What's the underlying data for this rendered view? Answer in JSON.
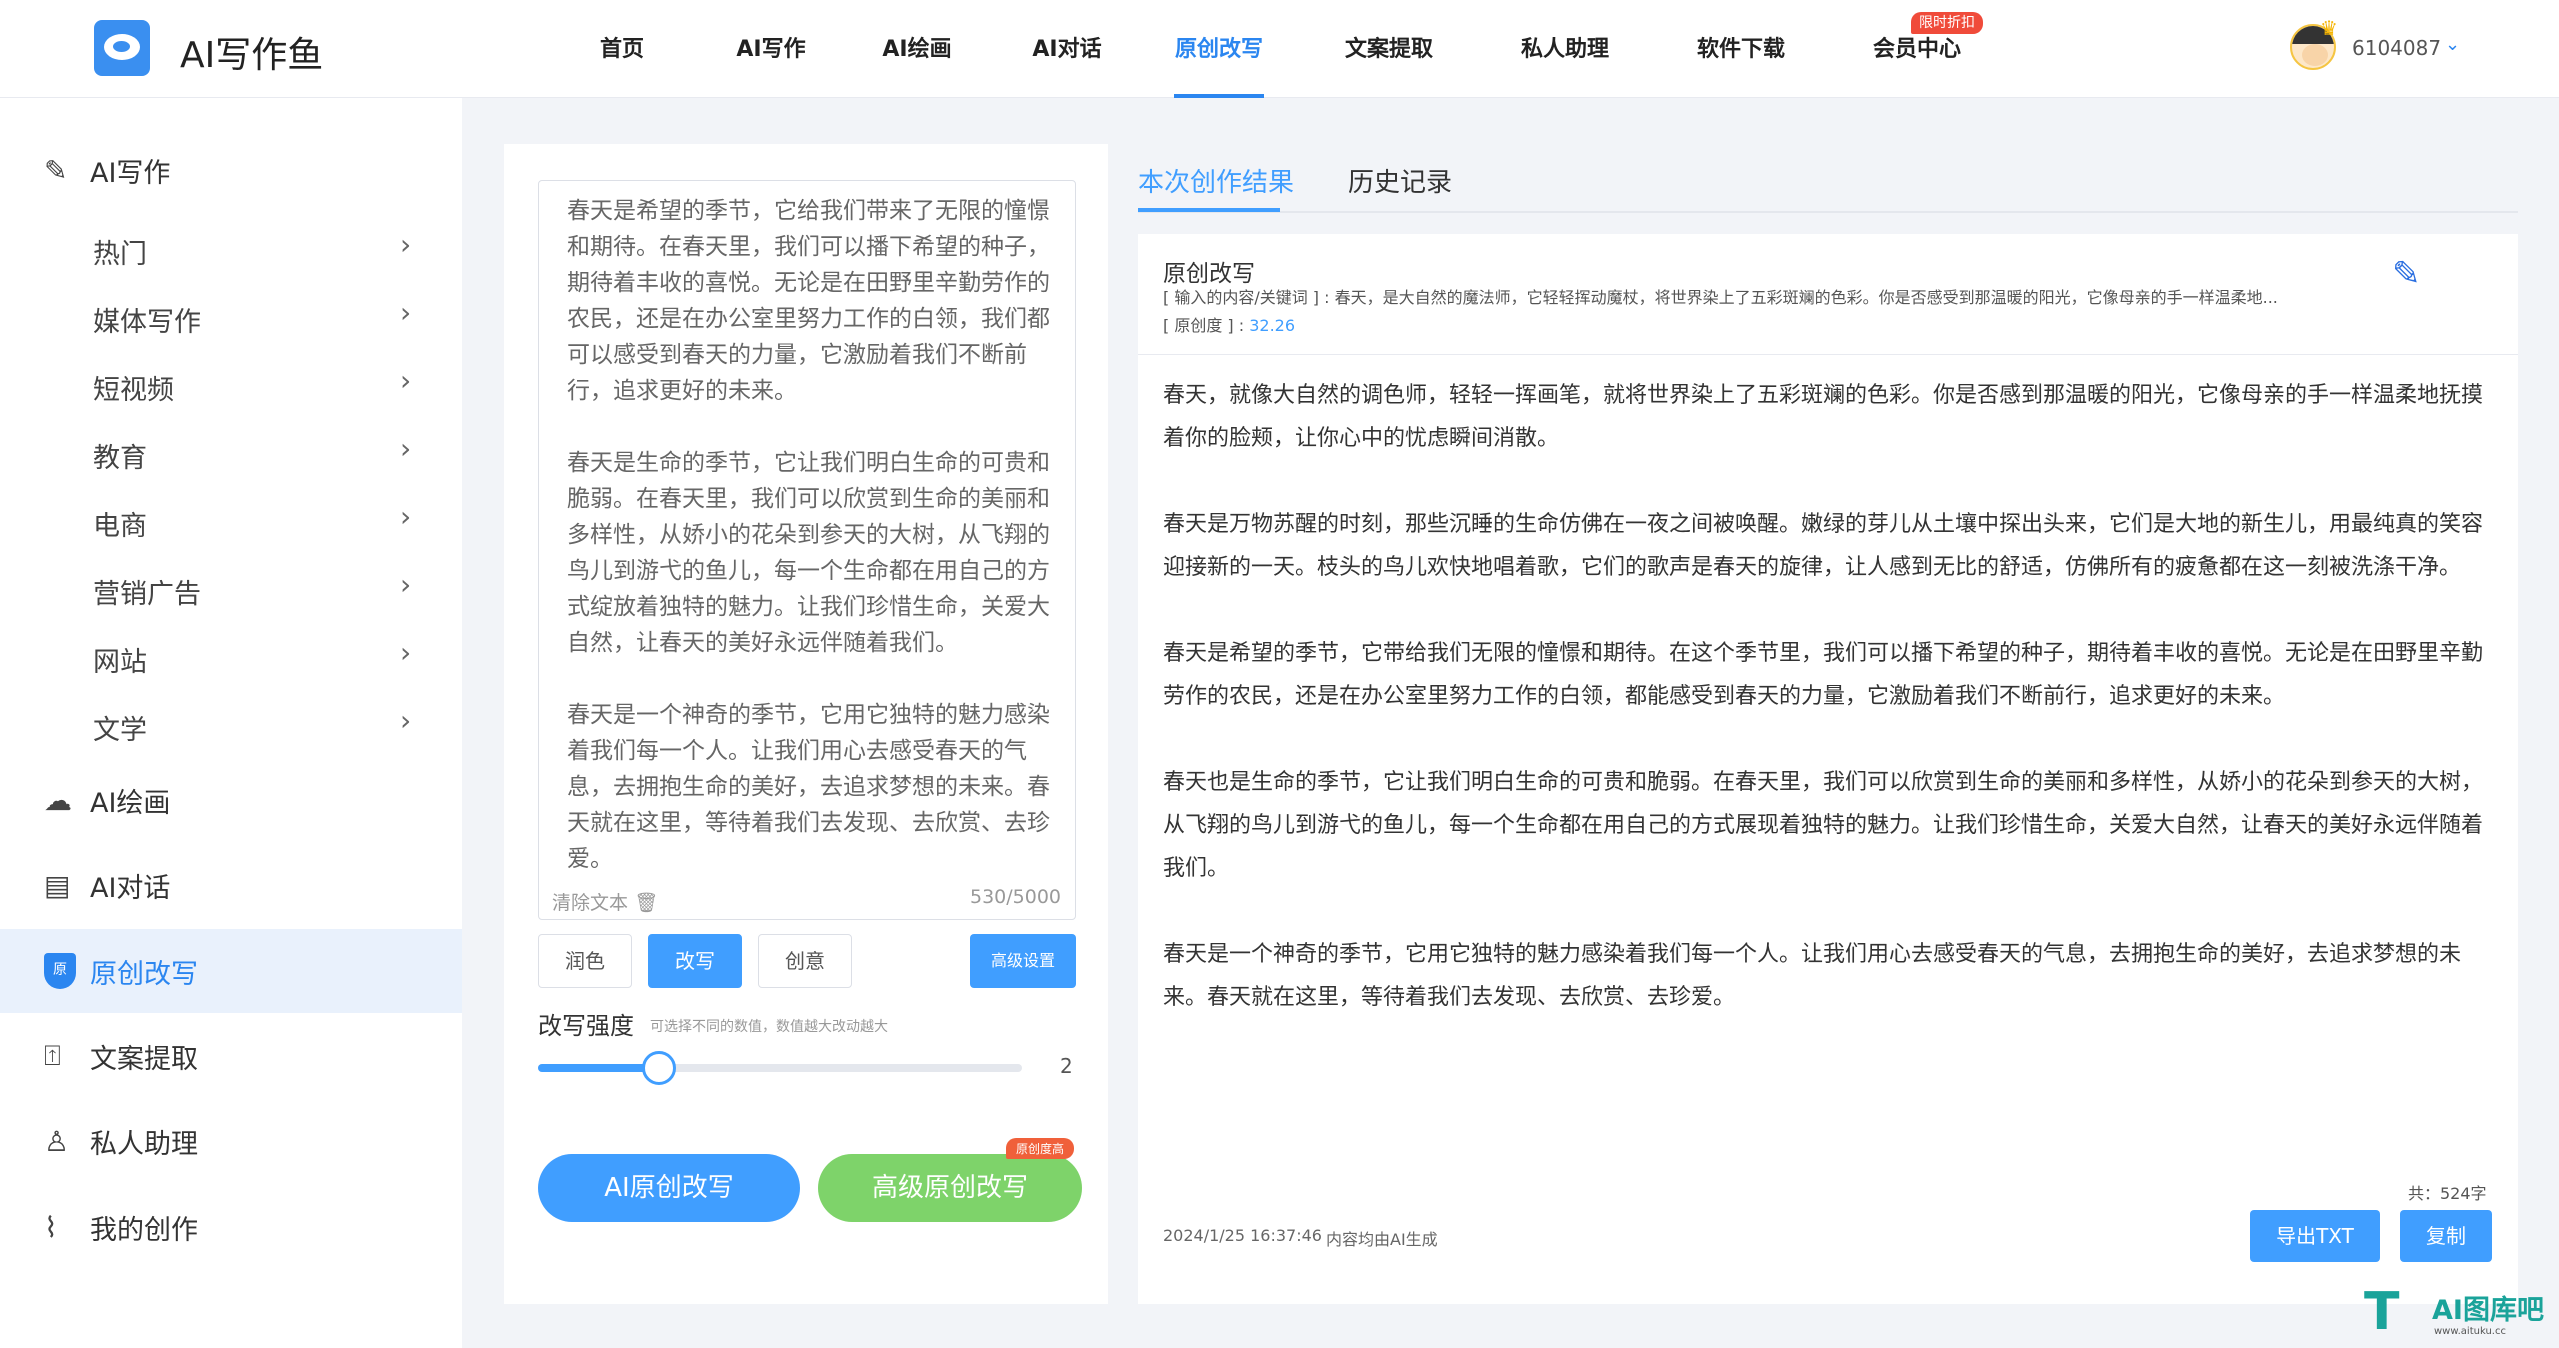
{
  "brand": {
    "name": "AI写作鱼"
  },
  "nav": {
    "items": [
      "首页",
      "AI写作",
      "AI绘画",
      "AI对话",
      "原创改写",
      "文案提取",
      "私人助理",
      "软件下载",
      "会员中心"
    ],
    "active": "原创改写",
    "promo_badge": "限时折扣"
  },
  "user": {
    "id": "6104087"
  },
  "sidebar": {
    "ai_writing": "AI写作",
    "subitems": [
      "热门",
      "媒体写作",
      "短视频",
      "教育",
      "电商",
      "营销广告",
      "网站",
      "文学"
    ],
    "ai_painting": "AI绘画",
    "ai_chat": "AI对话",
    "rewrite": "原创改写",
    "shield_text": "原",
    "extract": "文案提取",
    "assistant": "私人助理",
    "my_works": "我的创作"
  },
  "editor": {
    "text": "春天是希望的季节，它给我们带来了无限的憧憬和期待。在春天里，我们可以播下希望的种子，期待着丰收的喜悦。无论是在田野里辛勤劳作的农民，还是在办公室里努力工作的白领，我们都可以感受到春天的力量，它激励着我们不断前行，追求更好的未来。\n\n春天是生命的季节，它让我们明白生命的可贵和脆弱。在春天里，我们可以欣赏到生命的美丽和多样性，从娇小的花朵到参天的大树，从飞翔的鸟儿到游弋的鱼儿，每一个生命都在用自己的方式绽放着独特的魅力。让我们珍惜生命，关爱大自然，让春天的美好永远伴随着我们。\n\n春天是一个神奇的季节，它用它独特的魅力感染着我们每一个人。让我们用心去感受春天的气息，去拥抱生命的美好，去追求梦想的未来。春天就在这里，等待着我们去发现、去欣赏、去珍爱。",
    "clear_label": "清除文本",
    "char_count": "530/5000",
    "modes": [
      "润色",
      "改写",
      "创意"
    ],
    "active_mode": "改写",
    "advanced_label": "高级设置",
    "strength_label": "改写强度",
    "strength_hint": "可选择不同的数值，数值越大改动越大",
    "strength_value": "2",
    "strength_fraction": 0.25,
    "btn_rewrite": "AI原创改写",
    "btn_advanced_rewrite": "高级原创改写",
    "badge_high": "原创度高"
  },
  "results": {
    "tabs": [
      "本次创作结果",
      "历史记录"
    ],
    "active_tab": "本次创作结果",
    "title": "原创改写",
    "input_label": "[ 输入的内容/关键词 ] :",
    "input_value": "春天，是大自然的魔法师，它轻轻挥动魔杖，将世界染上了五彩斑斓的色彩。你是否感受到那温暖的阳光，它像母亲的手一样温柔地...",
    "originality_label": "[ 原创度 ] :",
    "originality_value": "32.26",
    "text": "春天，就像大自然的调色师，轻轻一挥画笔，就将世界染上了五彩斑斓的色彩。你是否感到那温暖的阳光，它像母亲的手一样温柔地抚摸着你的脸颊，让你心中的忧虑瞬间消散。\n\n春天是万物苏醒的时刻，那些沉睡的生命仿佛在一夜之间被唤醒。嫩绿的芽儿从土壤中探出头来，它们是大地的新生儿，用最纯真的笑容迎接新的一天。枝头的鸟儿欢快地唱着歌，它们的歌声是春天的旋律，让人感到无比的舒适，仿佛所有的疲惫都在这一刻被洗涤干净。\n\n春天是希望的季节，它带给我们无限的憧憬和期待。在这个季节里，我们可以播下希望的种子，期待着丰收的喜悦。无论是在田野里辛勤劳作的农民，还是在办公室里努力工作的白领，都能感受到春天的力量，它激励着我们不断前行，追求更好的未来。\n\n春天也是生命的季节，它让我们明白生命的可贵和脆弱。在春天里，我们可以欣赏到生命的美丽和多样性，从娇小的花朵到参天的大树，从飞翔的鸟儿到游弋的鱼儿，每一个生命都在用自己的方式展现着独特的魅力。让我们珍惜生命，关爱大自然，让春天的美好永远伴随着我们。\n\n春天是一个神奇的季节，它用它独特的魅力感染着我们每一个人。让我们用心去感受春天的气息，去拥抱生命的美好，去追求梦想的未来。春天就在这里，等待着我们去发现、去欣赏、去珍爱。",
    "total": "共：524字",
    "timestamp": "2024/1/25 16:37:46",
    "note": "内容均由AI生成",
    "btn_export": "导出TXT",
    "btn_copy": "复制"
  },
  "watermark": {
    "logo": "T",
    "name": "AI图库吧",
    "url": "www.aituku.cc"
  },
  "colors": {
    "accent": "#409eff",
    "green": "#7ed36a",
    "promo": "#f04b3a"
  }
}
